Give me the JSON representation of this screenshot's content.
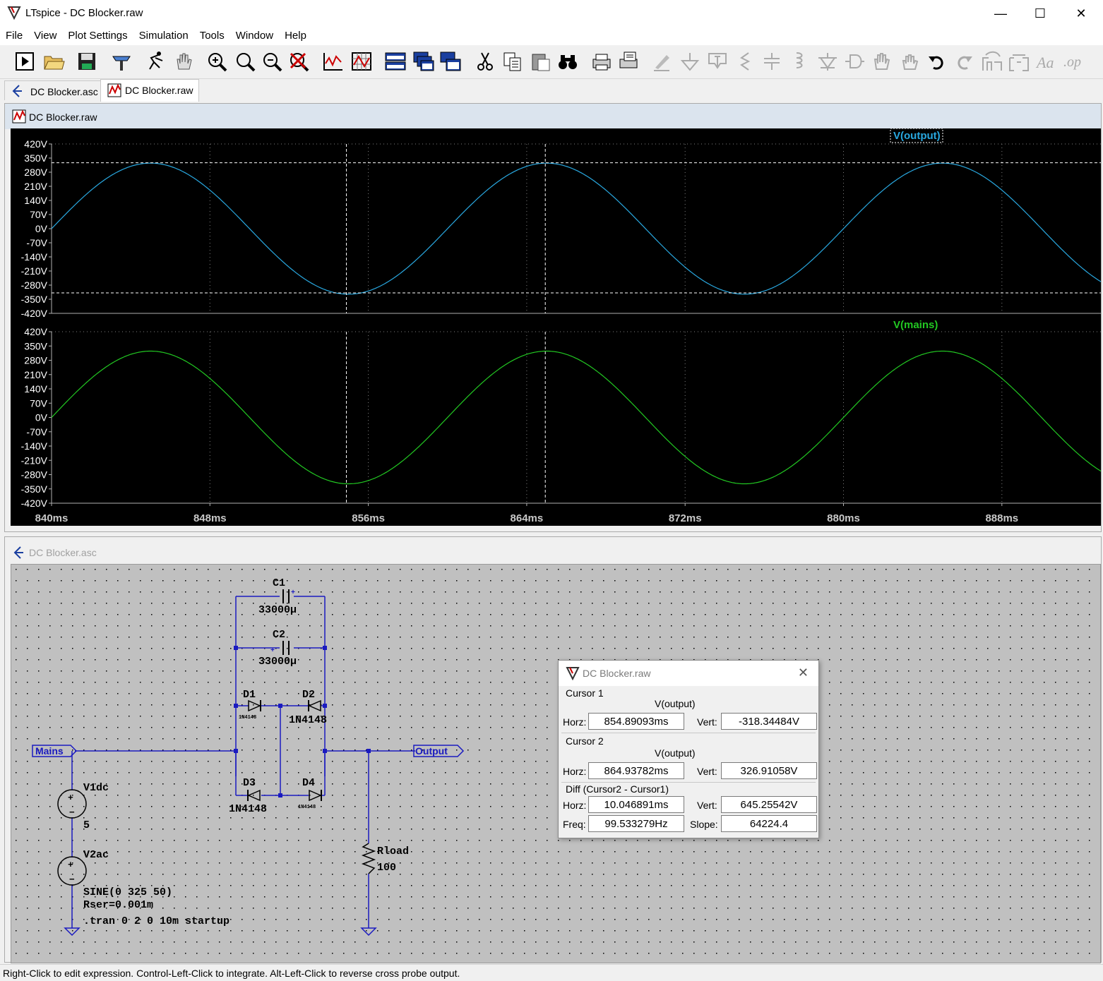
{
  "app": {
    "title": "LTspice - DC Blocker.raw"
  },
  "menu": [
    "File",
    "View",
    "Plot Settings",
    "Simulation",
    "Tools",
    "Window",
    "Help"
  ],
  "tabs": [
    {
      "label": "DC Blocker.asc"
    },
    {
      "label": "DC Blocker.raw"
    }
  ],
  "plot_window": {
    "title": "DC Blocker.raw"
  },
  "schematic_window": {
    "title": "DC Blocker.asc"
  },
  "chart_data": [
    {
      "type": "line",
      "series": [
        {
          "name": "V(output)",
          "color": "#29a8e0",
          "function": "325*sin(2*pi*50*t)"
        }
      ],
      "xlim": [
        "840ms",
        "893ms"
      ],
      "ylim": [
        -420,
        420
      ],
      "yticks": [
        "420V",
        "350V",
        "280V",
        "210V",
        "140V",
        "70V",
        "0V",
        "-70V",
        "-140V",
        "-210V",
        "-280V",
        "-350V",
        "-420V"
      ],
      "cursors": {
        "x": [
          "854.89093ms",
          "864.93782ms"
        ],
        "y": [
          "-318.34484V",
          "326.91058V"
        ]
      }
    },
    {
      "type": "line",
      "series": [
        {
          "name": "V(mains)",
          "color": "#22c822",
          "function": "325*sin(2*pi*50*t)"
        }
      ],
      "xlim": [
        "840ms",
        "893ms"
      ],
      "ylim": [
        -420,
        420
      ],
      "yticks": [
        "420V",
        "350V",
        "280V",
        "210V",
        "140V",
        "70V",
        "0V",
        "-70V",
        "-140V",
        "-210V",
        "-280V",
        "-350V",
        "-420V"
      ],
      "xticks": [
        "840ms",
        "848ms",
        "856ms",
        "864ms",
        "872ms",
        "880ms",
        "888ms"
      ]
    }
  ],
  "schematic": {
    "labels": {
      "c1": "C1",
      "c1v": "33000µ",
      "c2": "C2",
      "c2v": "33000µ",
      "d1": "D1",
      "d1m": "1N4148",
      "d2": "D2",
      "d2m": "1N4148",
      "d3": "D3",
      "d3m": "1N4148",
      "d4": "D4",
      "d4m": "1N4148",
      "mains": "Mains",
      "output": "Output",
      "v1": "V1dc",
      "v1v": "5",
      "v2": "V2ac",
      "v2v1": "SINE(0 325 50)",
      "v2v2": "Rser=0.001m",
      "tran": ".tran 0 2 0 10m startup",
      "rl": "Rload",
      "rlv": "100"
    }
  },
  "cursor_dialog": {
    "title": "DC Blocker.raw",
    "cursor1": {
      "label": "Cursor 1",
      "trace": "V(output)",
      "horz_label": "Horz:",
      "horz": "854.89093ms",
      "vert_label": "Vert:",
      "vert": "-318.34484V"
    },
    "cursor2": {
      "label": "Cursor 2",
      "trace": "V(output)",
      "horz_label": "Horz:",
      "horz": "864.93782ms",
      "vert_label": "Vert:",
      "vert": "326.91058V"
    },
    "diff": {
      "label": "Diff (Cursor2 - Cursor1)",
      "horz_label": "Horz:",
      "horz": "10.046891ms",
      "vert_label": "Vert:",
      "vert": "645.25542V",
      "freq_label": "Freq:",
      "freq": "99.533279Hz",
      "slope_label": "Slope:",
      "slope": "64224.4"
    }
  },
  "status": {
    "text": "Right-Click to edit expression. Control-Left-Click to integrate. Alt-Left-Click to reverse cross probe output."
  }
}
